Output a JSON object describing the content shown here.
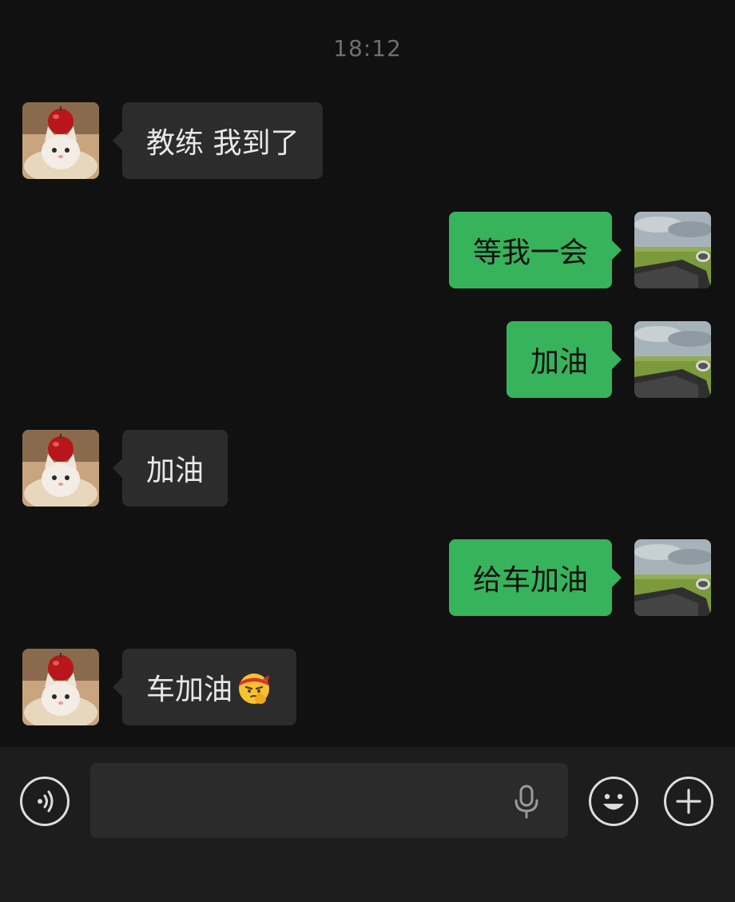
{
  "chat": {
    "timestamp": "18:12",
    "messages": [
      {
        "sender": "contact",
        "text": "教练 我到了"
      },
      {
        "sender": "me",
        "text": "等我一会"
      },
      {
        "sender": "me",
        "text": "加油"
      },
      {
        "sender": "contact",
        "text": "加油"
      },
      {
        "sender": "me",
        "text": "给车加油"
      },
      {
        "sender": "contact",
        "text": "车加油",
        "emoji": "thinking-face-with-headband-icon"
      }
    ]
  },
  "input_bar": {
    "voice_icon": "voice-mode-icon",
    "mic_icon": "microphone-icon",
    "emoji_icon": "smiley-icon",
    "more_icon": "plus-icon"
  },
  "colors": {
    "background": "#111111",
    "incoming_bubble": "#2c2c2c",
    "outgoing_bubble": "#37b35b",
    "input_bar": "#1d1d1d"
  }
}
